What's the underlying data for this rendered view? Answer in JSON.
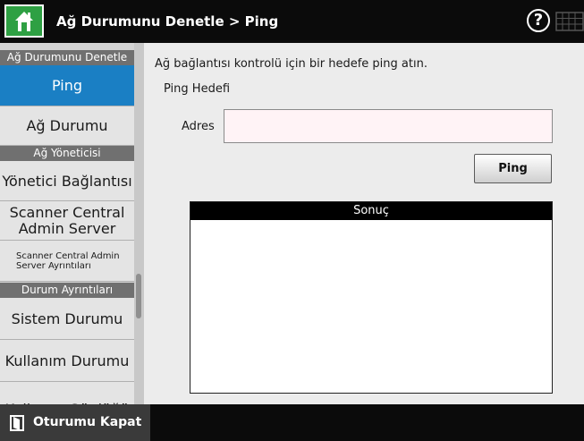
{
  "header": {
    "title": "Ağ Durumunu Denetle > Ping",
    "help_glyph": "?",
    "icons": {
      "home": "home-icon",
      "help": "help-icon",
      "keyboard": "keyboard-icon"
    },
    "colors": {
      "bar": "#0b0b0b",
      "home": "#2ea043"
    }
  },
  "sidebar": {
    "sections": [
      {
        "header": "Ağ Durumunu Denetle",
        "items": [
          "Ping",
          "Ağ Durumu"
        ]
      },
      {
        "header": "Ağ Yöneticisi",
        "items": [
          "Yönetici Bağlantısı",
          "Scanner Central Admin Server",
          "Scanner Central Admin Server Ayrıntıları"
        ]
      },
      {
        "header": "Durum Ayrıntıları",
        "items": [
          "Sistem Durumu",
          "Kullanım Durumu",
          "Kullanıcı Günlüğü"
        ]
      }
    ],
    "active_item": "Ping",
    "colors": {
      "active": "#1a7fc4"
    }
  },
  "main": {
    "instruction": "Ağ bağlantısı kontrolü için bir hedefe ping atın.",
    "ping_target_label": "Ping Hedefi",
    "address_label": "Adres",
    "address_value": "",
    "ping_button": "Ping",
    "result_header": "Sonuç",
    "result_text": ""
  },
  "footer": {
    "logout_label": "Oturumu Kapat",
    "icon": "logout-icon"
  }
}
